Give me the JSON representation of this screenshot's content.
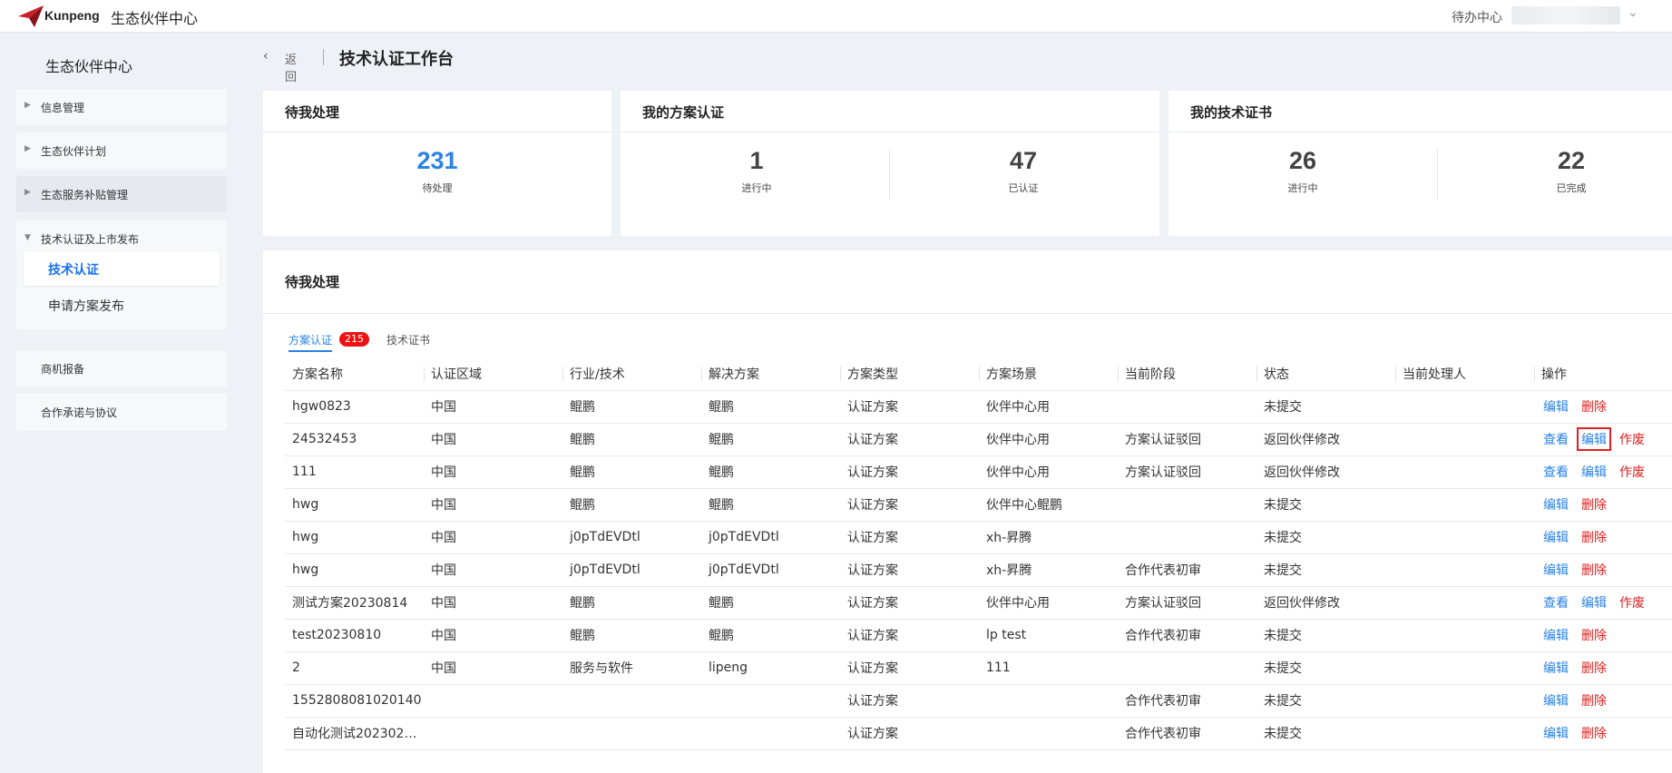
{
  "header": {
    "logo_text": "Kunpeng",
    "brand_title": "生态伙伴中心",
    "todo_center": "待办中心",
    "colors": {
      "brand_red": "#c8202a",
      "accent_blue": "#2a82e4"
    }
  },
  "sidebar": {
    "title": "生态伙伴中心",
    "items": [
      {
        "label": "信息管理"
      },
      {
        "label": "生态伙伴计划"
      },
      {
        "label": "生态服务补贴管理"
      },
      {
        "label": "技术认证及上市发布",
        "children": [
          {
            "label": "技术认证"
          },
          {
            "label": "申请方案发布"
          }
        ]
      },
      {
        "label": "商机报备"
      },
      {
        "label": "合作承诺与协议"
      }
    ]
  },
  "breadcrumb": {
    "back": "返回",
    "title": "技术认证工作台"
  },
  "cards": {
    "pending": {
      "title": "待我处理",
      "value": "231",
      "caption": "待处理"
    },
    "solution": {
      "title": "我的方案认证",
      "stats": [
        {
          "value": "1",
          "caption": "进行中"
        },
        {
          "value": "47",
          "caption": "已认证"
        }
      ]
    },
    "certificate": {
      "title": "我的技术证书",
      "stats": [
        {
          "value": "26",
          "caption": "进行中"
        },
        {
          "value": "22",
          "caption": "已完成"
        }
      ]
    }
  },
  "list": {
    "title": "待我处理",
    "tabs": [
      {
        "label": "方案认证",
        "badge": "215"
      },
      {
        "label": "技术证书"
      }
    ],
    "columns": [
      "方案名称",
      "认证区域",
      "行业/技术",
      "解决方案",
      "方案类型",
      "方案场景",
      "当前阶段",
      "状态",
      "当前处理人",
      "操作"
    ],
    "rows": [
      {
        "cells": [
          "hgw0823",
          "中国",
          "鲲鹏",
          "鲲鹏",
          "认证方案",
          "伙伴中心用",
          "",
          "未提交",
          ""
        ],
        "actions": [
          "编辑",
          "删除"
        ]
      },
      {
        "cells": [
          "24532453",
          "中国",
          "鲲鹏",
          "鲲鹏",
          "认证方案",
          "伙伴中心用",
          "方案认证驳回",
          "返回伙伴修改",
          ""
        ],
        "actions": [
          "查看",
          "编辑",
          "作废"
        ]
      },
      {
        "cells": [
          "111",
          "中国",
          "鲲鹏",
          "鲲鹏",
          "认证方案",
          "伙伴中心用",
          "方案认证驳回",
          "返回伙伴修改",
          ""
        ],
        "actions": [
          "查看",
          "编辑",
          "作废"
        ]
      },
      {
        "cells": [
          "hwg",
          "中国",
          "鲲鹏",
          "鲲鹏",
          "认证方案",
          "伙伴中心鲲鹏",
          "",
          "未提交",
          ""
        ],
        "actions": [
          "编辑",
          "删除"
        ]
      },
      {
        "cells": [
          "hwg",
          "中国",
          "j0pTdEVDtl",
          "j0pTdEVDtl",
          "认证方案",
          "xh-昇腾",
          "",
          "未提交",
          ""
        ],
        "actions": [
          "编辑",
          "删除"
        ]
      },
      {
        "cells": [
          "hwg",
          "中国",
          "j0pTdEVDtl",
          "j0pTdEVDtl",
          "认证方案",
          "xh-昇腾",
          "合作代表初审",
          "未提交",
          ""
        ],
        "actions": [
          "编辑",
          "删除"
        ]
      },
      {
        "cells": [
          "测试方案20230814",
          "中国",
          "鲲鹏",
          "鲲鹏",
          "认证方案",
          "伙伴中心用",
          "方案认证驳回",
          "返回伙伴修改",
          ""
        ],
        "actions": [
          "查看",
          "编辑",
          "作废"
        ]
      },
      {
        "cells": [
          "test20230810",
          "中国",
          "鲲鹏",
          "鲲鹏",
          "认证方案",
          "lp test",
          "合作代表初审",
          "未提交",
          ""
        ],
        "actions": [
          "编辑",
          "删除"
        ]
      },
      {
        "cells": [
          "2",
          "中国",
          "服务与软件",
          "lipeng",
          "认证方案",
          "111",
          "",
          "未提交",
          ""
        ],
        "actions": [
          "编辑",
          "删除"
        ]
      },
      {
        "cells": [
          "1552808081020140",
          "",
          "",
          "",
          "认证方案",
          "",
          "合作代表初审",
          "未提交",
          ""
        ],
        "actions": [
          "编辑",
          "删除"
        ]
      },
      {
        "cells": [
          "自动化测试2023021...",
          "",
          "",
          "",
          "认证方案",
          "",
          "合作代表初审",
          "未提交",
          ""
        ],
        "actions": [
          "编辑",
          "删除"
        ]
      }
    ]
  }
}
